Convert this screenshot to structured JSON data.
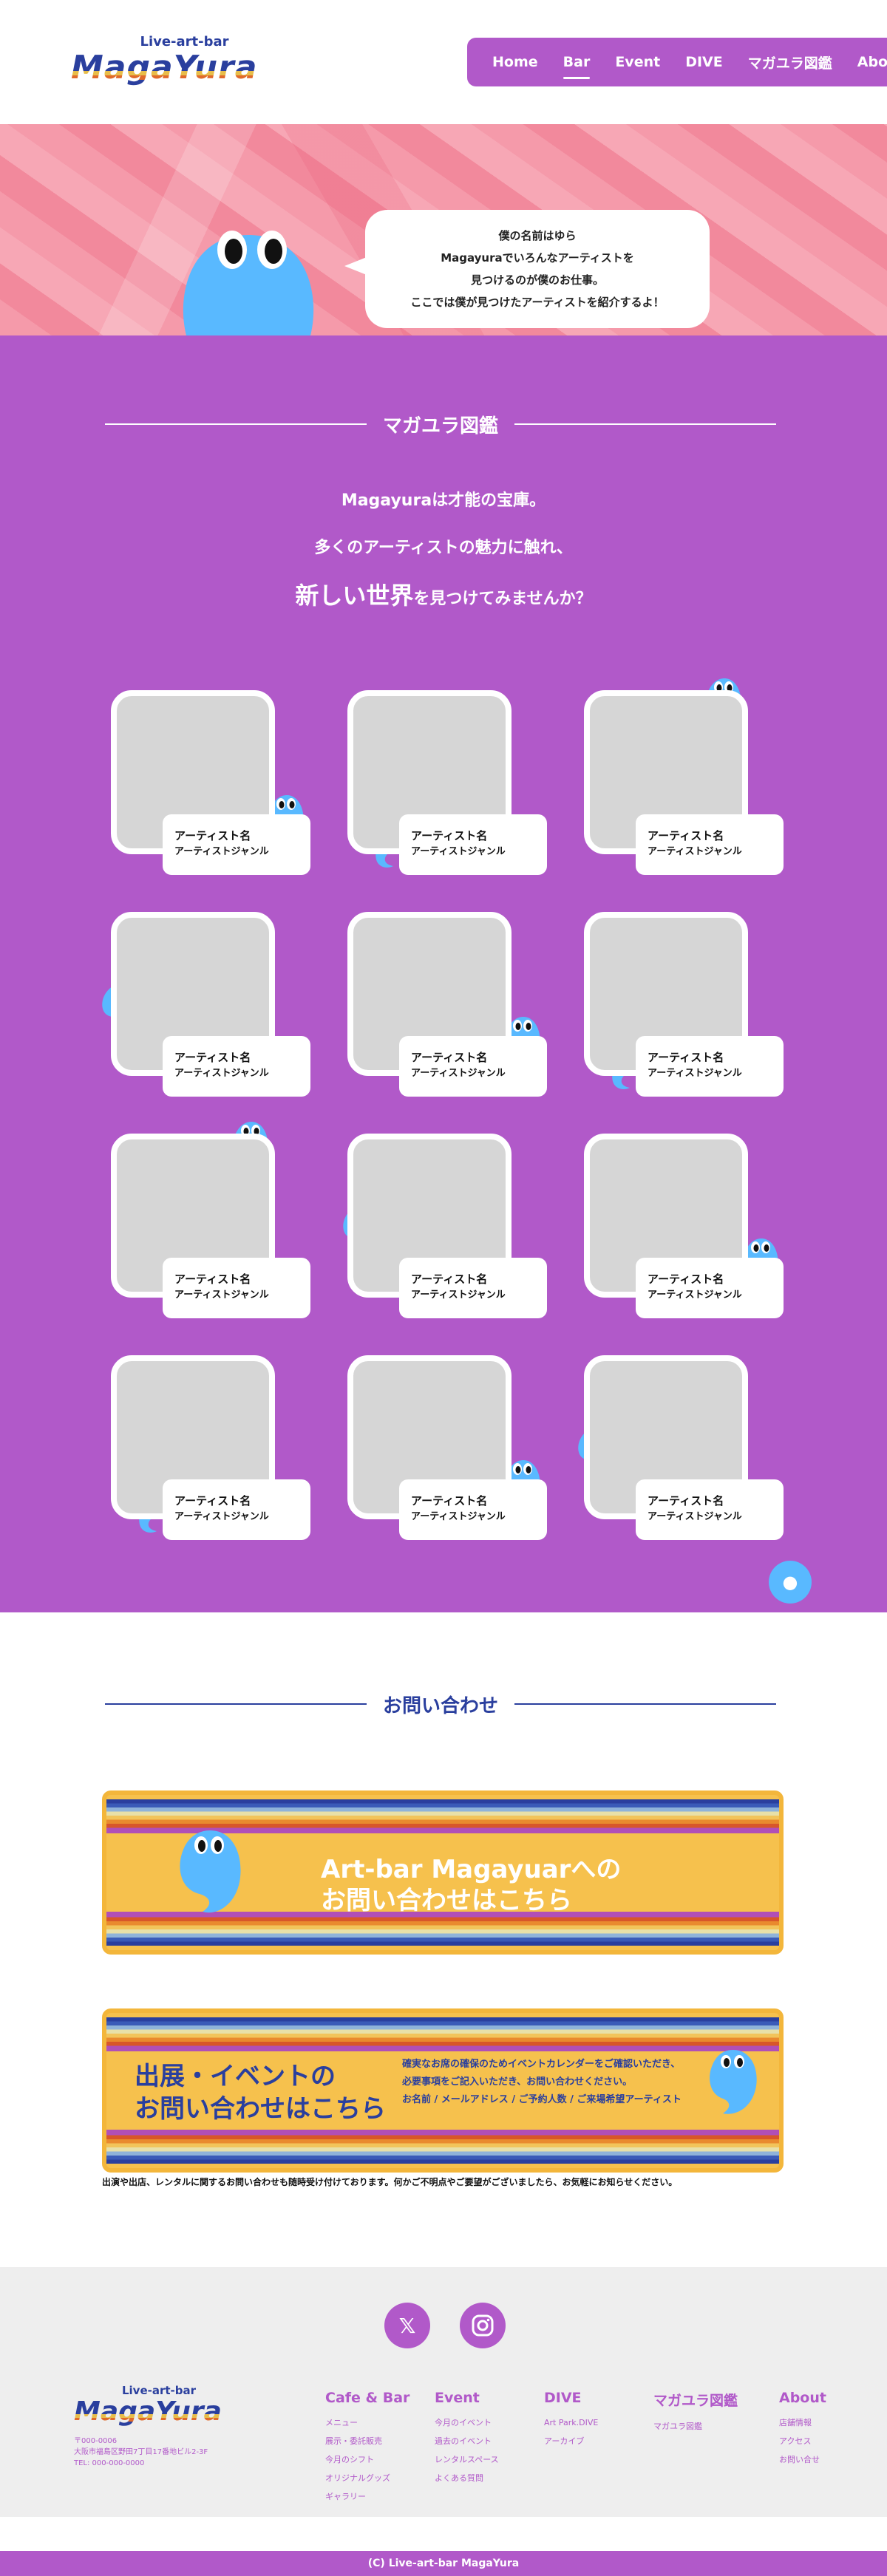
{
  "header": {
    "logo_tagline": "Live-art-bar",
    "logo_word": "MagaYura",
    "nav": [
      "Home",
      "Bar",
      "Event",
      "DIVE",
      "マガユラ図鑑",
      "About"
    ],
    "nav_active": "Bar"
  },
  "hero": {
    "bubble_lines": [
      "僕の名前はゆら",
      "Magayuraでいろんなアーティストを",
      "見つけるのが僕のお仕事。",
      "ここでは僕が見つけたアーティストを紹介するよ！"
    ]
  },
  "zukan": {
    "title": "マガユラ図鑑",
    "intro1": "Magayuraは才能の宝庫。",
    "intro2": "多くのアーティストの魅力に触れ、",
    "intro3_big": "新しい世界",
    "intro3_rest": "を見つけてみませんか？",
    "cards": [
      {
        "name": "アーティスト名",
        "genre": "アーティストジャンル"
      },
      {
        "name": "アーティスト名",
        "genre": "アーティストジャンル"
      },
      {
        "name": "アーティスト名",
        "genre": "アーティストジャンル"
      },
      {
        "name": "アーティスト名",
        "genre": "アーティストジャンル"
      },
      {
        "name": "アーティスト名",
        "genre": "アーティストジャンル"
      },
      {
        "name": "アーティスト名",
        "genre": "アーティストジャンル"
      },
      {
        "name": "アーティスト名",
        "genre": "アーティストジャンル"
      },
      {
        "name": "アーティスト名",
        "genre": "アーティストジャンル"
      },
      {
        "name": "アーティスト名",
        "genre": "アーティストジャンル"
      },
      {
        "name": "アーティスト名",
        "genre": "アーティストジャンル"
      },
      {
        "name": "アーティスト名",
        "genre": "アーティストジャンル"
      },
      {
        "name": "アーティスト名",
        "genre": "アーティストジャンル"
      }
    ]
  },
  "contact": {
    "title": "お問い合わせ",
    "banner1_line1": "Art-bar Magayuarへの",
    "banner1_line2": "お問い合わせはこちら",
    "banner2_line1": "出展・イベントの",
    "banner2_line2": "お問い合わせはこちら",
    "banner2_note1": "確実なお席の確保のためイベントカレンダーをご確認いただき、",
    "banner2_note2": "必要事項をご記入いただき、お問い合わせください。",
    "banner2_note3": "お名前 / メールアドレス / ご予約人数 / ご来場希望アーティスト",
    "note": "出演や出店、レンタルに関するお問い合わせも随時受け付けております。何かご不明点やご要望がございましたら、お気軽にお知らせください。"
  },
  "footer": {
    "sns": [
      "X",
      "Instagram"
    ],
    "logo_tagline": "Live-art-bar",
    "logo_word": "MagaYura",
    "address_lines": [
      "〒000-0006",
      "大阪市福島区野田7丁目17番地ビル2-3F",
      "TEL: 000-000-0000"
    ],
    "columns": [
      {
        "title": "Cafe & Bar",
        "links": [
          "メニュー",
          "展示・委託販売",
          "今月のシフト",
          "オリジナルグッズ",
          "ギャラリー"
        ]
      },
      {
        "title": "Event",
        "links": [
          "今月のイベント",
          "過去のイベント",
          "レンタルスペース",
          "よくある質問"
        ]
      },
      {
        "title": "DIVE",
        "links": [
          "Art Park.DIVE",
          "アーカイブ"
        ]
      },
      {
        "title": "マガユラ図鑑",
        "links": [
          "マガユラ図鑑"
        ]
      },
      {
        "title": "About",
        "links": [
          "店舗情報",
          "アクセス",
          "お問い合せ"
        ]
      }
    ],
    "copyright": "(C) Live-art-bar MagaYura"
  },
  "colors": {
    "purple": "#b159c9",
    "navy": "#2a3f9e",
    "ghost": "#59b9ff",
    "yellow": "#f6c14d",
    "pink": "#f48fa0"
  }
}
